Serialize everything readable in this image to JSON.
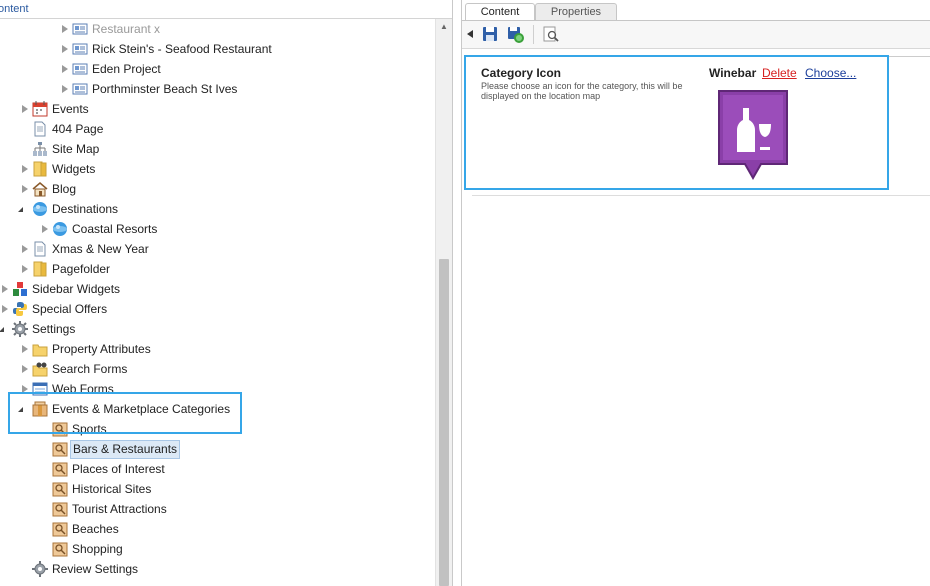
{
  "tree": {
    "header": "ontent",
    "items": [
      {
        "label": "Restaurant x",
        "icon": "page-card-icon"
      },
      {
        "label": "Rick Stein's - Seafood Restaurant",
        "icon": "page-card-icon"
      },
      {
        "label": "Eden Project",
        "icon": "page-card-icon"
      },
      {
        "label": "Porthminster Beach St Ives",
        "icon": "page-card-icon"
      },
      {
        "label": "Events",
        "icon": "calendar-icon"
      },
      {
        "label": "404 Page",
        "icon": "document-icon"
      },
      {
        "label": "Site Map",
        "icon": "sitemap-icon"
      },
      {
        "label": "Widgets",
        "icon": "folder-icon"
      },
      {
        "label": "Blog",
        "icon": "home-icon"
      },
      {
        "label": "Destinations",
        "icon": "globe-icon"
      },
      {
        "label": "Coastal Resorts",
        "icon": "globe-icon"
      },
      {
        "label": "Xmas & New Year",
        "icon": "document-icon"
      },
      {
        "label": "Pagefolder",
        "icon": "folder-icon"
      },
      {
        "label": "Sidebar Widgets",
        "icon": "blocks-icon"
      },
      {
        "label": "Special Offers",
        "icon": "python-icon"
      },
      {
        "label": "Settings",
        "icon": "gear-icon"
      },
      {
        "label": "Property Attributes",
        "icon": "folder-icon"
      },
      {
        "label": "Search Forms",
        "icon": "folder-binoculars-icon"
      },
      {
        "label": "Web Forms",
        "icon": "web-form-icon"
      },
      {
        "label": "Events & Marketplace Categories",
        "icon": "package-icon"
      },
      {
        "label": "Sports",
        "icon": "category-icon"
      },
      {
        "label": "Bars & Restaurants",
        "icon": "category-icon"
      },
      {
        "label": "Places of Interest",
        "icon": "category-icon"
      },
      {
        "label": "Historical Sites",
        "icon": "category-icon"
      },
      {
        "label": "Tourist Attractions",
        "icon": "category-icon"
      },
      {
        "label": "Beaches",
        "icon": "category-icon"
      },
      {
        "label": "Shopping",
        "icon": "category-icon"
      },
      {
        "label": "Review Settings",
        "icon": "gear-icon"
      }
    ]
  },
  "tabs": {
    "content": "Content",
    "properties": "Properties"
  },
  "toolbar": {
    "icons": [
      "collapse-arrow-icon",
      "save-icon",
      "save-publish-icon",
      "preview-icon"
    ]
  },
  "property": {
    "name": "Category Icon",
    "description": "Please choose an icon for the category, this will be displayed on the location map",
    "icon_name": "Winebar",
    "delete_label": "Delete",
    "choose_label": "Choose...",
    "icon_color": "#8a3fa8"
  },
  "colors": {
    "highlight": "#35a6e8",
    "selected_bg": "#dce9f6"
  }
}
